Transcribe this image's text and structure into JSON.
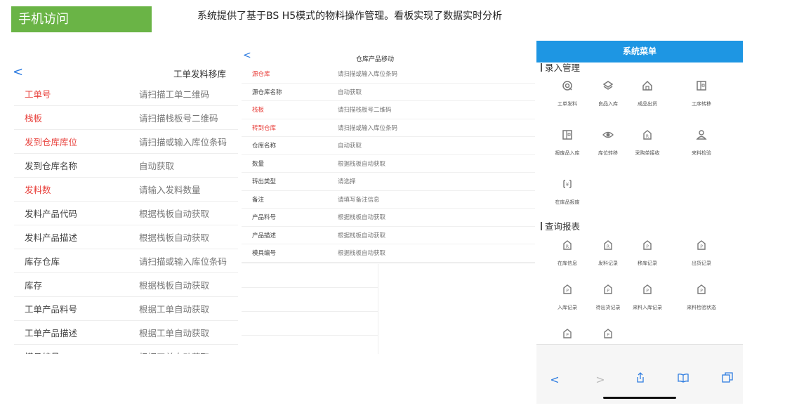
{
  "header": {
    "tag_label": "手机访问",
    "caption": "系统提供了基于BS H5模式的物料操作管理。看板实现了数据实时分析"
  },
  "panel1": {
    "back_glyph": "<",
    "title": "工单发料移库",
    "rows": [
      {
        "label": "工单号",
        "value": "请扫描工单二维码",
        "required": true
      },
      {
        "label": "栈板",
        "value": "请扫描栈板号二维码",
        "required": true
      },
      {
        "label": "发到仓库库位",
        "value": "请扫描或输入库位条码",
        "required": true
      },
      {
        "label": "发到仓库名称",
        "value": "自动获取",
        "required": false
      },
      {
        "label": "发料数",
        "value": "请输入发料数量",
        "required": true
      },
      {
        "label": "发料产品代码",
        "value": "根据栈板自动获取",
        "required": false
      },
      {
        "label": "发料产品描述",
        "value": "根据栈板自动获取",
        "required": false
      },
      {
        "label": "库存仓库",
        "value": "请扫描或输入库位条码",
        "required": false
      },
      {
        "label": "库存",
        "value": "根据栈板自动获取",
        "required": false
      },
      {
        "label": "工单产品料号",
        "value": "根据工单自动获取",
        "required": false
      },
      {
        "label": "工单产品描述",
        "value": "根据工单自动获取",
        "required": false
      },
      {
        "label": "模具编号",
        "value": "根据工单自动获取",
        "required": false
      }
    ]
  },
  "panel2": {
    "back_glyph": "<",
    "title": "仓库产品移动",
    "rows": [
      {
        "label": "源仓库",
        "value": "请扫描或输入库位条码",
        "required": true
      },
      {
        "label": "源仓库名称",
        "value": "自动获取",
        "required": false
      },
      {
        "label": "栈板",
        "value": "请扫描栈板号二维码",
        "required": true
      },
      {
        "label": "转到仓库",
        "value": "请扫描或输入库位条码",
        "required": true
      },
      {
        "label": "仓库名称",
        "value": "自动获取",
        "required": false
      },
      {
        "label": "数量",
        "value": "根据栈板自动获取",
        "required": false
      },
      {
        "label": "转出类型",
        "value": "请选择",
        "required": false
      },
      {
        "label": "备注",
        "value": "请填写备注信息",
        "required": false
      },
      {
        "label": "产品料号",
        "value": "根据栈板自动获取",
        "required": false
      },
      {
        "label": "产品描述",
        "value": "根据栈板自动获取",
        "required": false
      },
      {
        "label": "模具编号",
        "value": "根据栈板自动获取",
        "required": false
      }
    ]
  },
  "phone": {
    "title": "系统菜单",
    "section_entry": "录入管理",
    "section_report": "查询报表",
    "entry_items": [
      {
        "label": "工单发料",
        "icon": "target-icon"
      },
      {
        "label": "良品入库",
        "icon": "layers-icon"
      },
      {
        "label": "成品出货",
        "icon": "home-icon"
      },
      {
        "label": "工序转移",
        "icon": "building-icon"
      },
      {
        "label": "报废品入库",
        "icon": "building-icon"
      },
      {
        "label": "库位转移",
        "icon": "eye-icon"
      },
      {
        "label": "采购单接收",
        "icon": "receipt-icon"
      },
      {
        "label": "来料检验",
        "icon": "user-icon"
      },
      {
        "label": "在库品报废",
        "icon": "scan-icon"
      }
    ],
    "report_items": [
      {
        "label": "在库信息",
        "icon": "r-bag-icon"
      },
      {
        "label": "发料记录",
        "icon": "r-bag-icon"
      },
      {
        "label": "移库记录",
        "icon": "p-bag-icon"
      },
      {
        "label": "出货记录",
        "icon": "p-bag-icon"
      },
      {
        "label": "入库记录",
        "icon": "p-bag-icon"
      },
      {
        "label": "待出货记录",
        "icon": "p-bag-icon"
      },
      {
        "label": "来料入库记录",
        "icon": "p-bag-icon"
      },
      {
        "label": "来料检验状态",
        "icon": "p-bag-icon"
      },
      {
        "label": "",
        "icon": "p-bag-icon"
      },
      {
        "label": "",
        "icon": "p-bag-icon"
      }
    ],
    "toolbar": [
      {
        "icon": "back-arrow-icon",
        "glyph": "<"
      },
      {
        "icon": "forward-arrow-icon",
        "glyph": ">"
      },
      {
        "icon": "share-icon",
        "glyph": ""
      },
      {
        "icon": "bookmarks-icon",
        "glyph": ""
      },
      {
        "icon": "tabs-icon",
        "glyph": ""
      }
    ],
    "colors": {
      "header": "#1e96e3",
      "icon": "#777777",
      "toolbar_accent": "#2f7de1"
    }
  }
}
